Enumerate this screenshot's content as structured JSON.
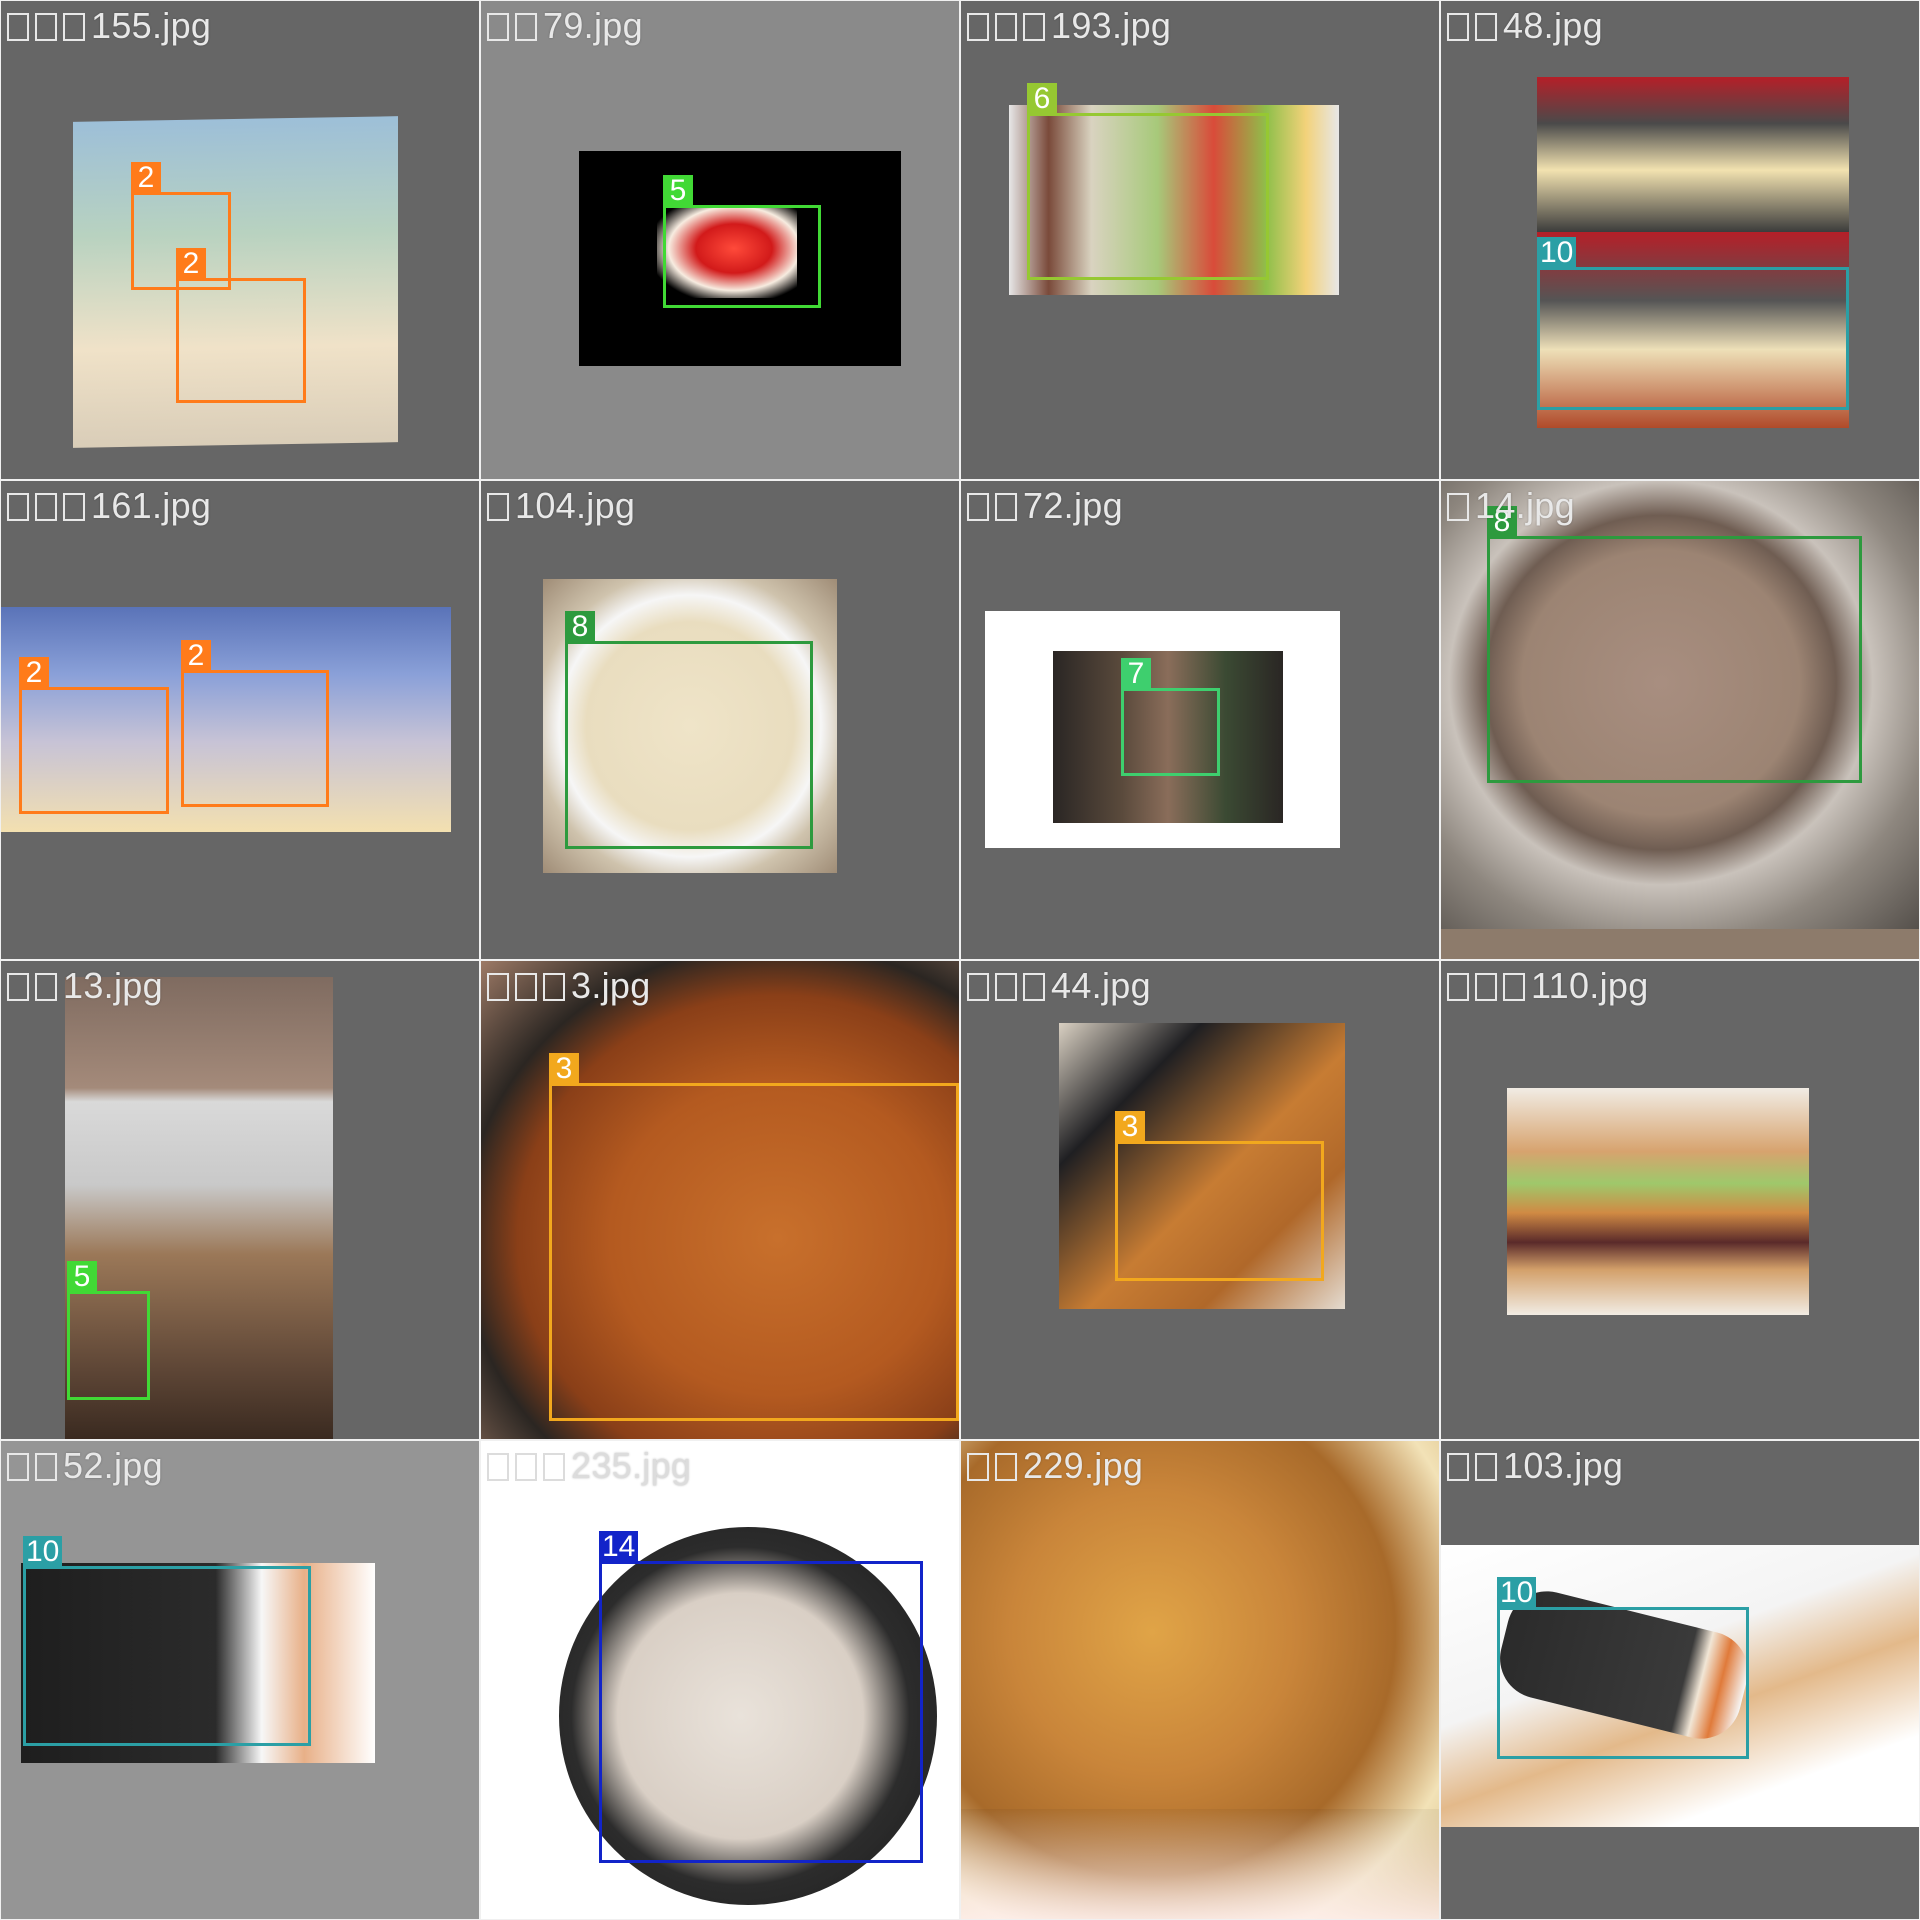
{
  "grid": {
    "tiles": [
      {
        "filename": "155.jpg",
        "prefix_glyphs": 3,
        "detections": [
          {
            "cls": "2",
            "color": "#ff7b1a"
          },
          {
            "cls": "2",
            "color": "#ff7b1a"
          }
        ]
      },
      {
        "filename": "79.jpg",
        "prefix_glyphs": 2,
        "detections": [
          {
            "cls": "5",
            "color": "#41d935"
          }
        ]
      },
      {
        "filename": "193.jpg",
        "prefix_glyphs": 3,
        "detections": [
          {
            "cls": "6",
            "color": "#96c832"
          }
        ]
      },
      {
        "filename": "48.jpg",
        "prefix_glyphs": 2,
        "detections": [
          {
            "cls": "10",
            "color": "#2b9fa5"
          }
        ]
      },
      {
        "filename": "161.jpg",
        "prefix_glyphs": 3,
        "detections": [
          {
            "cls": "2",
            "color": "#ff7b1a"
          },
          {
            "cls": "2",
            "color": "#ff7b1a"
          }
        ]
      },
      {
        "filename": "104.jpg",
        "prefix_glyphs": 1,
        "detections": [
          {
            "cls": "8",
            "color": "#2d9a3e"
          }
        ]
      },
      {
        "filename": "72.jpg",
        "prefix_glyphs": 2,
        "detections": [
          {
            "cls": "7",
            "color": "#3ecf6e"
          }
        ]
      },
      {
        "filename": "14.jpg",
        "prefix_glyphs": 1,
        "detections": [
          {
            "cls": "8",
            "color": "#2d9a3e"
          }
        ]
      },
      {
        "filename": "13.jpg",
        "prefix_glyphs": 2,
        "detections": [
          {
            "cls": "5",
            "color": "#41d935"
          }
        ]
      },
      {
        "filename": "3.jpg",
        "prefix_glyphs": 3,
        "detections": [
          {
            "cls": "3",
            "color": "#f2a81d"
          }
        ]
      },
      {
        "filename": "44.jpg",
        "prefix_glyphs": 3,
        "detections": [
          {
            "cls": "3",
            "color": "#f2a81d"
          }
        ]
      },
      {
        "filename": "110.jpg",
        "prefix_glyphs": 3,
        "detections": []
      },
      {
        "filename": "52.jpg",
        "prefix_glyphs": 2,
        "detections": [
          {
            "cls": "10",
            "color": "#2b9fa5"
          }
        ]
      },
      {
        "filename": "235.jpg",
        "prefix_glyphs": 3,
        "detections": [
          {
            "cls": "14",
            "color": "#1224c9"
          }
        ]
      },
      {
        "filename": "229.jpg",
        "prefix_glyphs": 2,
        "detections": []
      },
      {
        "filename": "103.jpg",
        "prefix_glyphs": 2,
        "detections": [
          {
            "cls": "10",
            "color": "#2b9fa5"
          }
        ]
      }
    ]
  }
}
